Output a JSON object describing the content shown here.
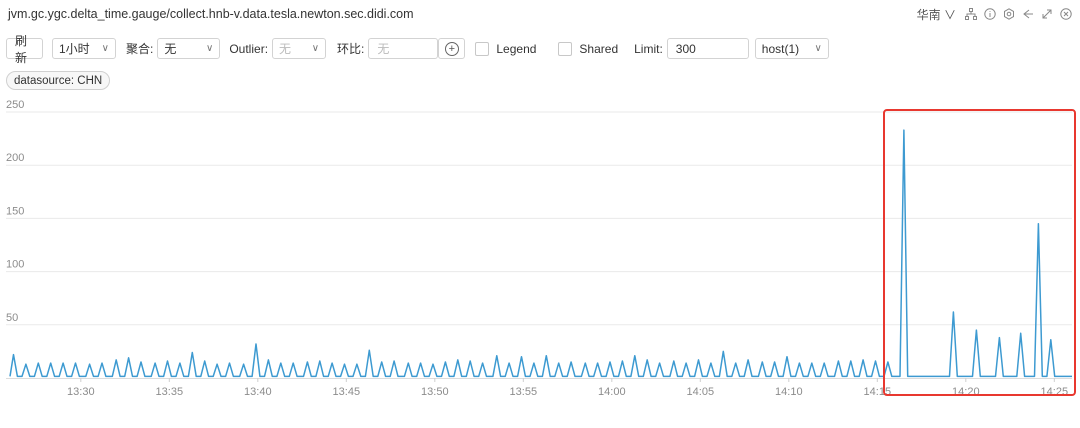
{
  "header": {
    "title": "jvm.gc.ygc.delta_time.gauge/collect.hnb-v.data.tesla.newton.sec.didi.com",
    "region": "华南",
    "icons": [
      "chevron-down-icon",
      "tree-icon",
      "info-icon",
      "gear-icon",
      "share-icon",
      "expand-icon",
      "close-icon"
    ]
  },
  "toolbar": {
    "refresh_label": "刷 新",
    "time_range": "1小时",
    "aggregate_label": "聚合:",
    "aggregate_value": "无",
    "outlier_label": "Outlier:",
    "outlier_value": "无",
    "ratio_label": "环比:",
    "ratio_placeholder": "无",
    "legend_label": "Legend",
    "shared_label": "Shared",
    "limit_label": "Limit:",
    "limit_value": "300",
    "host_value": "host(1)"
  },
  "tags": {
    "datasource": "datasource: CHN"
  },
  "accent": {
    "line": "#3d9ad1",
    "highlight": "#e8382f"
  },
  "chart_data": {
    "type": "line",
    "title": "",
    "xlabel": "",
    "ylabel": "",
    "ylim": [
      0,
      250
    ],
    "yticks": [
      50,
      100,
      150,
      200,
      250
    ],
    "x_range_minutes": [
      0,
      60
    ],
    "xticks": [
      {
        "m": 4,
        "label": "13:30"
      },
      {
        "m": 9,
        "label": "13:35"
      },
      {
        "m": 14,
        "label": "13:40"
      },
      {
        "m": 19,
        "label": "13:45"
      },
      {
        "m": 24,
        "label": "13:50"
      },
      {
        "m": 29,
        "label": "13:55"
      },
      {
        "m": 34,
        "label": "14:00"
      },
      {
        "m": 39,
        "label": "14:05"
      },
      {
        "m": 44,
        "label": "14:10"
      },
      {
        "m": 49,
        "label": "14:15"
      },
      {
        "m": 54,
        "label": "14:20"
      },
      {
        "m": 59,
        "label": "14:25"
      }
    ],
    "grid": true,
    "series": [
      {
        "spikes": [
          [
            0.2,
            22
          ],
          [
            0.9,
            13
          ],
          [
            1.6,
            14
          ],
          [
            2.3,
            14
          ],
          [
            3.0,
            14
          ],
          [
            3.7,
            14
          ],
          [
            4.5,
            13
          ],
          [
            5.2,
            14
          ],
          [
            6.0,
            17
          ],
          [
            6.7,
            19
          ],
          [
            7.4,
            15
          ],
          [
            8.2,
            14
          ],
          [
            8.9,
            16
          ],
          [
            9.6,
            14
          ],
          [
            10.3,
            24
          ],
          [
            11.0,
            16
          ],
          [
            11.7,
            13
          ],
          [
            12.4,
            14
          ],
          [
            13.2,
            13
          ],
          [
            13.9,
            32
          ],
          [
            14.6,
            17
          ],
          [
            15.3,
            14
          ],
          [
            16.0,
            14
          ],
          [
            16.8,
            15
          ],
          [
            17.5,
            16
          ],
          [
            18.2,
            14
          ],
          [
            18.9,
            13
          ],
          [
            19.6,
            13
          ],
          [
            20.3,
            26
          ],
          [
            21.0,
            15
          ],
          [
            21.7,
            16
          ],
          [
            22.5,
            14
          ],
          [
            23.2,
            14
          ],
          [
            23.9,
            13
          ],
          [
            24.6,
            15
          ],
          [
            25.3,
            17
          ],
          [
            26.0,
            16
          ],
          [
            26.7,
            14
          ],
          [
            27.5,
            21
          ],
          [
            28.2,
            14
          ],
          [
            28.9,
            20
          ],
          [
            29.6,
            14
          ],
          [
            30.3,
            21
          ],
          [
            31.0,
            14
          ],
          [
            31.7,
            15
          ],
          [
            32.5,
            14
          ],
          [
            33.2,
            14
          ],
          [
            33.9,
            15
          ],
          [
            34.6,
            16
          ],
          [
            35.3,
            21
          ],
          [
            36.0,
            17
          ],
          [
            36.7,
            14
          ],
          [
            37.5,
            16
          ],
          [
            38.2,
            14
          ],
          [
            38.9,
            17
          ],
          [
            39.6,
            14
          ],
          [
            40.3,
            25
          ],
          [
            41.0,
            14
          ],
          [
            41.7,
            17
          ],
          [
            42.5,
            15
          ],
          [
            43.2,
            15
          ],
          [
            43.9,
            20
          ],
          [
            44.6,
            14
          ],
          [
            45.3,
            14
          ],
          [
            46.0,
            14
          ],
          [
            46.8,
            16
          ],
          [
            47.5,
            16
          ],
          [
            48.2,
            17
          ],
          [
            48.9,
            16
          ],
          [
            49.6,
            15
          ],
          [
            50.5,
            233
          ],
          [
            53.3,
            62
          ],
          [
            54.6,
            45
          ],
          [
            55.9,
            38
          ],
          [
            57.1,
            42
          ],
          [
            58.1,
            145
          ],
          [
            58.8,
            36
          ]
        ],
        "gaps": [
          [
            51.3,
            52.9
          ]
        ]
      }
    ]
  }
}
